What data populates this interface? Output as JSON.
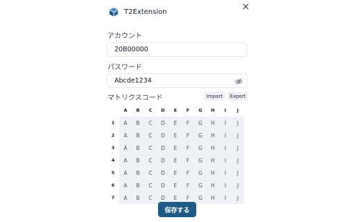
{
  "header": {
    "title": "T2Extension",
    "logo_icon": "box-icon",
    "close_icon": "close-icon"
  },
  "account": {
    "label": "アカウント",
    "value": "20B00000"
  },
  "password": {
    "label": "パスワード",
    "value": "Abcde1234",
    "toggle_icon": "eye-off-icon"
  },
  "matrix": {
    "label": "マトリクスコード",
    "import_label": "Import",
    "export_label": "Export",
    "columns": [
      "A",
      "B",
      "C",
      "D",
      "E",
      "F",
      "G",
      "H",
      "I",
      "J"
    ],
    "rows": [
      {
        "label": "1",
        "cells": [
          "A",
          "B",
          "C",
          "D",
          "E",
          "F",
          "G",
          "H",
          "I",
          "J"
        ]
      },
      {
        "label": "2",
        "cells": [
          "A",
          "B",
          "C",
          "D",
          "E",
          "F",
          "G",
          "H",
          "I",
          "J"
        ]
      },
      {
        "label": "3",
        "cells": [
          "A",
          "B",
          "C",
          "D",
          "E",
          "F",
          "G",
          "H",
          "I",
          "J"
        ]
      },
      {
        "label": "4",
        "cells": [
          "A",
          "B",
          "C",
          "D",
          "E",
          "F",
          "G",
          "H",
          "I",
          "J"
        ]
      },
      {
        "label": "5",
        "cells": [
          "A",
          "B",
          "C",
          "D",
          "E",
          "F",
          "G",
          "H",
          "I",
          "J"
        ]
      },
      {
        "label": "6",
        "cells": [
          "A",
          "B",
          "C",
          "D",
          "E",
          "F",
          "G",
          "H",
          "I",
          "J"
        ]
      },
      {
        "label": "7",
        "cells": [
          "A",
          "B",
          "C",
          "D",
          "E",
          "F",
          "G",
          "H",
          "I",
          "J"
        ]
      }
    ]
  },
  "save_label": "保存する",
  "colors": {
    "primary": "#1f5a87",
    "cell_bg": "#eef1f5",
    "chip_bg": "#eef0f3"
  }
}
